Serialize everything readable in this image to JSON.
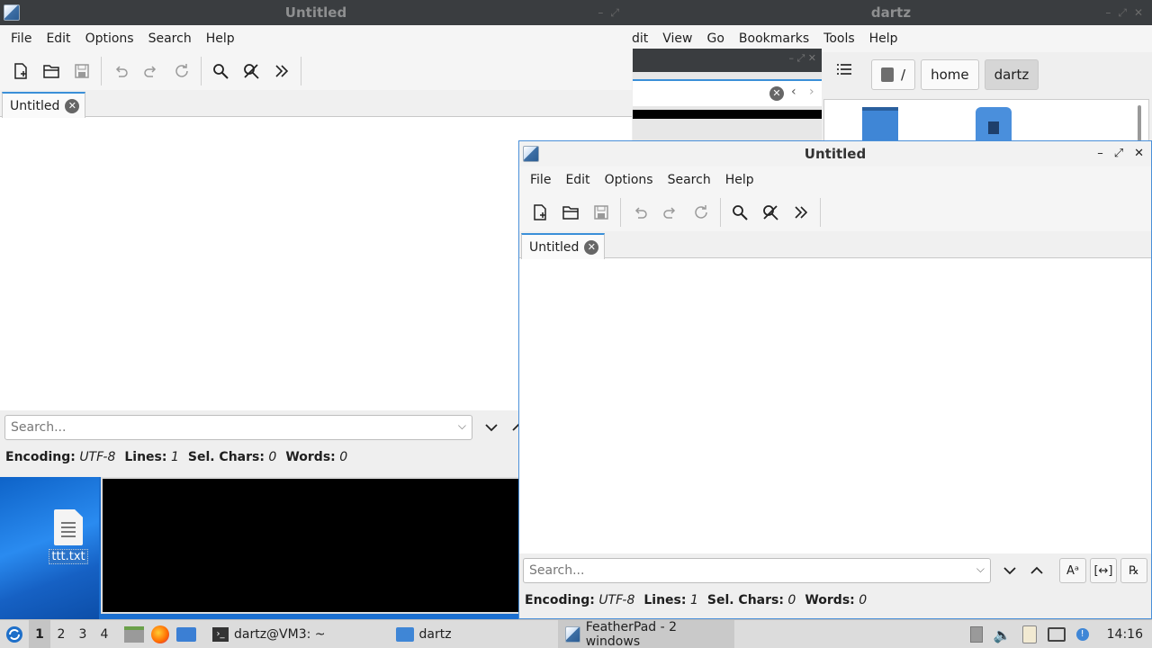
{
  "desktop": {
    "file_icon_label": "ttt.txt"
  },
  "file_manager": {
    "title": "dartz",
    "menu": [
      "dit",
      "View",
      "Go",
      "Bookmarks",
      "Tools",
      "Help"
    ],
    "breadcrumb": [
      "/",
      "home",
      "dartz"
    ]
  },
  "back_window": {
    "title": "Untitled",
    "menu": [
      "File",
      "Edit",
      "Options",
      "Search",
      "Help"
    ],
    "tab_label": "Untitled",
    "search_placeholder": "Search...",
    "status": {
      "encoding_label": "Encoding:",
      "encoding": "UTF-8",
      "lines_label": "Lines:",
      "lines": "1",
      "sel_label": "Sel. Chars:",
      "sel": "0",
      "words_label": "Words:",
      "words": "0"
    }
  },
  "front_window": {
    "title": "Untitled",
    "menu": [
      "File",
      "Edit",
      "Options",
      "Search",
      "Help"
    ],
    "tab_label": "Untitled",
    "search_placeholder": "Search...",
    "status": {
      "encoding_label": "Encoding:",
      "encoding": "UTF-8",
      "lines_label": "Lines:",
      "lines": "1",
      "sel_label": "Sel. Chars:",
      "sel": "0",
      "words_label": "Words:",
      "words": "0"
    }
  },
  "taskbar": {
    "workspaces": [
      "1",
      "2",
      "3",
      "4"
    ],
    "tasks": [
      "dartz@VM3: ~",
      "dartz",
      "FeatherPad - 2 windows"
    ],
    "clock": "14:16"
  }
}
